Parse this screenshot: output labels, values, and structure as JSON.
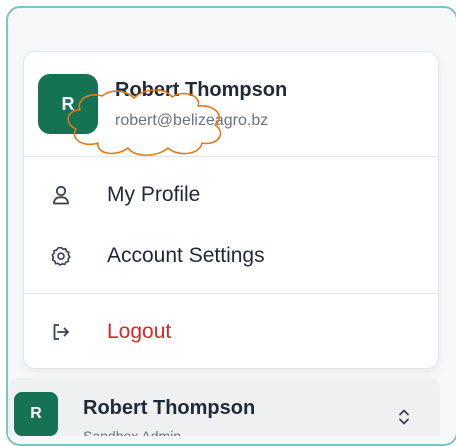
{
  "user_menu": {
    "avatar_initial": "R",
    "name": "Robert Thompson",
    "email": "robert@belizeagro.bz",
    "items": [
      {
        "label": "My Profile",
        "icon": "user-icon"
      },
      {
        "label": "Account Settings",
        "icon": "gear-icon"
      }
    ],
    "logout": {
      "label": "Logout",
      "icon": "logout-icon"
    }
  },
  "footer_user": {
    "avatar_initial": "R",
    "name": "Robert Thompson",
    "subtitle": "Sandbox Admin",
    "icon": "chevron-updown-icon"
  },
  "colors": {
    "accent": "#157253",
    "logout": "#dc2626",
    "annotation": "#e07a1a"
  }
}
